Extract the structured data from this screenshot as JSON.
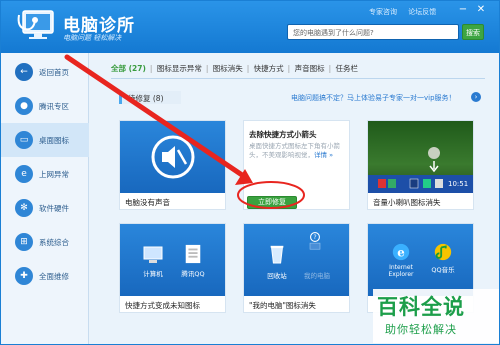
{
  "header": {
    "title": "电脑诊所",
    "slogan": "电脑问题 轻松解决",
    "links": [
      "专家咨询",
      "论坛反馈"
    ],
    "search_placeholder": "您的电脑遇到了什么问题?",
    "search_button": "搜索"
  },
  "sidebar": {
    "items": [
      {
        "label": "返回首页",
        "icon": "back-arrow-icon"
      },
      {
        "label": "腾讯专区",
        "icon": "penguin-icon"
      },
      {
        "label": "桌面图标",
        "icon": "monitor-icon"
      },
      {
        "label": "上网异常",
        "icon": "ie-icon"
      },
      {
        "label": "软件硬件",
        "icon": "gear-icon"
      },
      {
        "label": "系统综合",
        "icon": "system-icon"
      },
      {
        "label": "全面维修",
        "icon": "wrench-icon"
      }
    ]
  },
  "tabs": [
    "全部 (27)",
    "图标显示异常",
    "图标消失",
    "快捷方式",
    "声音图标",
    "任务栏"
  ],
  "subbar": {
    "label": "待修复 (8)",
    "link": "电脑问题搞不定？马上体验易子专家一对一vip服务！"
  },
  "cards": [
    {
      "caption": "电脑没有声音"
    },
    {
      "title": "去除快捷方式小箭头",
      "desc": "桌面快捷方式图标左下角有小箭头，不美观影响视觉，",
      "link": "详情 »",
      "button": "立即修复"
    },
    {
      "caption": "音量小喇叭图标消失",
      "clock": "10:51"
    },
    {
      "caption": "快捷方式变成未知图标",
      "icons": [
        "计算机",
        "腾讯QQ"
      ]
    },
    {
      "caption": "\"我的电脑\"图标消失",
      "icons": [
        "回收站",
        "我的电脑"
      ]
    },
    {
      "caption": "",
      "icons": [
        "Internet Explorer",
        "QQ音乐"
      ]
    }
  ],
  "watermark": {
    "top": "百科全说",
    "bottom": "助你轻松解决"
  },
  "colors": {
    "header": "#1a82dc",
    "green": "#3aa23f",
    "red_arrow": "#e8251f"
  }
}
